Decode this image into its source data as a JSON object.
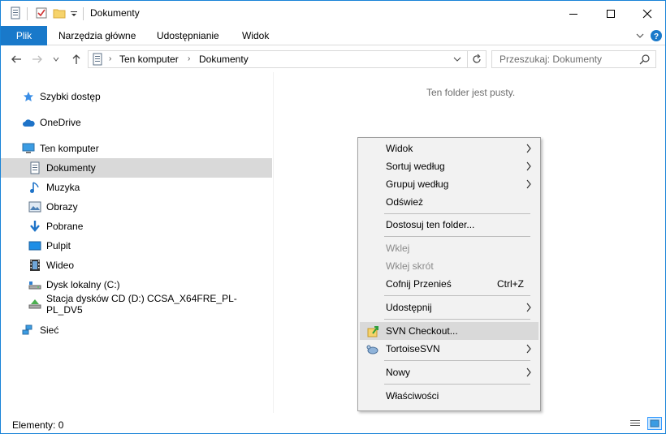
{
  "window": {
    "title": "Dokumenty",
    "accent_color": "#1979ca"
  },
  "ribbon": {
    "tabs": [
      "Plik",
      "Narzędzia główne",
      "Udostępnianie",
      "Widok"
    ]
  },
  "address": {
    "segments": [
      "Ten komputer",
      "Dokumenty"
    ]
  },
  "search": {
    "placeholder": "Przeszukaj: Dokumenty"
  },
  "navpane": {
    "quick_access": "Szybki dostęp",
    "onedrive": "OneDrive",
    "this_pc": "Ten komputer",
    "items": [
      {
        "label": "Dokumenty",
        "icon": "documents-icon",
        "selected": true
      },
      {
        "label": "Muzyka",
        "icon": "music-icon"
      },
      {
        "label": "Obrazy",
        "icon": "pictures-icon"
      },
      {
        "label": "Pobrane",
        "icon": "downloads-icon"
      },
      {
        "label": "Pulpit",
        "icon": "desktop-icon"
      },
      {
        "label": "Wideo",
        "icon": "video-icon"
      },
      {
        "label": "Dysk lokalny (C:)",
        "icon": "local-disk-icon"
      },
      {
        "label": "Stacja dysków CD (D:) CCSA_X64FRE_PL-PL_DV5",
        "icon": "cd-drive-icon"
      }
    ],
    "network": "Sieć"
  },
  "content": {
    "empty_message": "Ten folder jest pusty."
  },
  "status": {
    "items_count": "Elementy: 0"
  },
  "context_menu": {
    "items": [
      {
        "label": "Widok",
        "submenu": true
      },
      {
        "label": "Sortuj według",
        "submenu": true
      },
      {
        "label": "Grupuj według",
        "submenu": true
      },
      {
        "label": "Odśwież"
      },
      {
        "label": "Dostosuj ten folder..."
      },
      {
        "label": "Wklej",
        "disabled": true
      },
      {
        "label": "Wklej skrót",
        "disabled": true
      },
      {
        "label": "Cofnij Przenieś",
        "shortcut": "Ctrl+Z"
      },
      {
        "label": "Udostępnij",
        "submenu": true
      },
      {
        "label": "SVN Checkout...",
        "icon": "svn-checkout-icon",
        "highlighted": true
      },
      {
        "label": "TortoiseSVN",
        "icon": "tortoisesvn-icon",
        "submenu": true
      },
      {
        "label": "Nowy",
        "submenu": true
      },
      {
        "label": "Właściwości"
      }
    ]
  }
}
